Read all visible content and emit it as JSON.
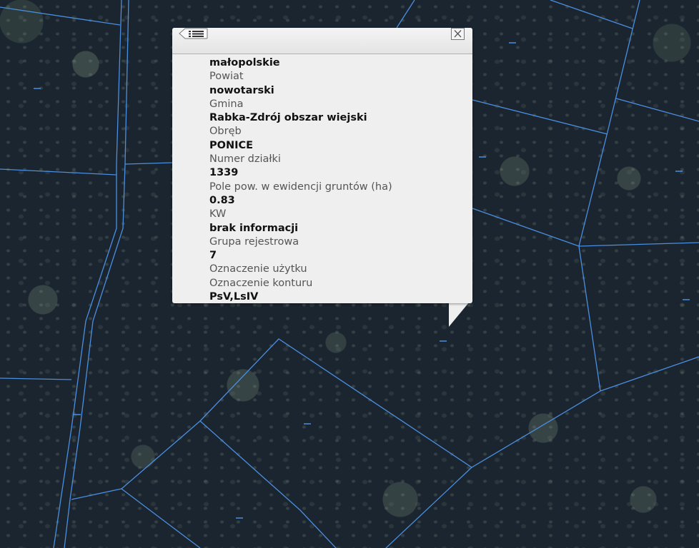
{
  "popup": {
    "menu_icon": "list-back-icon",
    "close_icon": "close-icon",
    "fields": [
      {
        "label": "",
        "value": "małopolskie"
      },
      {
        "label": "Powiat",
        "value": "nowotarski"
      },
      {
        "label": "Gmina",
        "value": "Rabka-Zdrój obszar wiejski"
      },
      {
        "label": "Obręb",
        "value": "PONICE"
      },
      {
        "label": "Numer działki",
        "value": "1339"
      },
      {
        "label": "Pole pow. w ewidencji gruntów (ha)",
        "value": "0.83"
      },
      {
        "label": "KW",
        "value": "brak informacji"
      },
      {
        "label": "Grupa rejestrowa",
        "value": "7"
      },
      {
        "label": "Oznaczenie użytku",
        "value": ""
      },
      {
        "label": "Oznaczenie konturu",
        "value": "PsV,LsIV"
      }
    ]
  },
  "map": {
    "basemap": "aerial-orthophoto-forest",
    "parcel_line_color": "#4a8fe0"
  }
}
